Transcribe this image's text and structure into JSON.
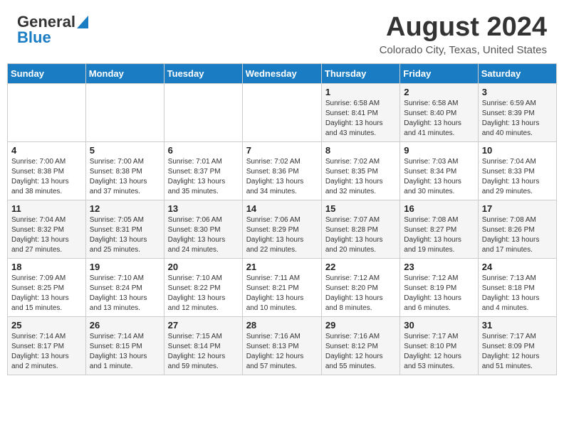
{
  "header": {
    "logo_line1": "General",
    "logo_line2": "Blue",
    "month_year": "August 2024",
    "location": "Colorado City, Texas, United States"
  },
  "weekdays": [
    "Sunday",
    "Monday",
    "Tuesday",
    "Wednesday",
    "Thursday",
    "Friday",
    "Saturday"
  ],
  "weeks": [
    [
      {
        "day": "",
        "info": ""
      },
      {
        "day": "",
        "info": ""
      },
      {
        "day": "",
        "info": ""
      },
      {
        "day": "",
        "info": ""
      },
      {
        "day": "1",
        "info": "Sunrise: 6:58 AM\nSunset: 8:41 PM\nDaylight: 13 hours\nand 43 minutes."
      },
      {
        "day": "2",
        "info": "Sunrise: 6:58 AM\nSunset: 8:40 PM\nDaylight: 13 hours\nand 41 minutes."
      },
      {
        "day": "3",
        "info": "Sunrise: 6:59 AM\nSunset: 8:39 PM\nDaylight: 13 hours\nand 40 minutes."
      }
    ],
    [
      {
        "day": "4",
        "info": "Sunrise: 7:00 AM\nSunset: 8:38 PM\nDaylight: 13 hours\nand 38 minutes."
      },
      {
        "day": "5",
        "info": "Sunrise: 7:00 AM\nSunset: 8:38 PM\nDaylight: 13 hours\nand 37 minutes."
      },
      {
        "day": "6",
        "info": "Sunrise: 7:01 AM\nSunset: 8:37 PM\nDaylight: 13 hours\nand 35 minutes."
      },
      {
        "day": "7",
        "info": "Sunrise: 7:02 AM\nSunset: 8:36 PM\nDaylight: 13 hours\nand 34 minutes."
      },
      {
        "day": "8",
        "info": "Sunrise: 7:02 AM\nSunset: 8:35 PM\nDaylight: 13 hours\nand 32 minutes."
      },
      {
        "day": "9",
        "info": "Sunrise: 7:03 AM\nSunset: 8:34 PM\nDaylight: 13 hours\nand 30 minutes."
      },
      {
        "day": "10",
        "info": "Sunrise: 7:04 AM\nSunset: 8:33 PM\nDaylight: 13 hours\nand 29 minutes."
      }
    ],
    [
      {
        "day": "11",
        "info": "Sunrise: 7:04 AM\nSunset: 8:32 PM\nDaylight: 13 hours\nand 27 minutes."
      },
      {
        "day": "12",
        "info": "Sunrise: 7:05 AM\nSunset: 8:31 PM\nDaylight: 13 hours\nand 25 minutes."
      },
      {
        "day": "13",
        "info": "Sunrise: 7:06 AM\nSunset: 8:30 PM\nDaylight: 13 hours\nand 24 minutes."
      },
      {
        "day": "14",
        "info": "Sunrise: 7:06 AM\nSunset: 8:29 PM\nDaylight: 13 hours\nand 22 minutes."
      },
      {
        "day": "15",
        "info": "Sunrise: 7:07 AM\nSunset: 8:28 PM\nDaylight: 13 hours\nand 20 minutes."
      },
      {
        "day": "16",
        "info": "Sunrise: 7:08 AM\nSunset: 8:27 PM\nDaylight: 13 hours\nand 19 minutes."
      },
      {
        "day": "17",
        "info": "Sunrise: 7:08 AM\nSunset: 8:26 PM\nDaylight: 13 hours\nand 17 minutes."
      }
    ],
    [
      {
        "day": "18",
        "info": "Sunrise: 7:09 AM\nSunset: 8:25 PM\nDaylight: 13 hours\nand 15 minutes."
      },
      {
        "day": "19",
        "info": "Sunrise: 7:10 AM\nSunset: 8:24 PM\nDaylight: 13 hours\nand 13 minutes."
      },
      {
        "day": "20",
        "info": "Sunrise: 7:10 AM\nSunset: 8:22 PM\nDaylight: 13 hours\nand 12 minutes."
      },
      {
        "day": "21",
        "info": "Sunrise: 7:11 AM\nSunset: 8:21 PM\nDaylight: 13 hours\nand 10 minutes."
      },
      {
        "day": "22",
        "info": "Sunrise: 7:12 AM\nSunset: 8:20 PM\nDaylight: 13 hours\nand 8 minutes."
      },
      {
        "day": "23",
        "info": "Sunrise: 7:12 AM\nSunset: 8:19 PM\nDaylight: 13 hours\nand 6 minutes."
      },
      {
        "day": "24",
        "info": "Sunrise: 7:13 AM\nSunset: 8:18 PM\nDaylight: 13 hours\nand 4 minutes."
      }
    ],
    [
      {
        "day": "25",
        "info": "Sunrise: 7:14 AM\nSunset: 8:17 PM\nDaylight: 13 hours\nand 2 minutes."
      },
      {
        "day": "26",
        "info": "Sunrise: 7:14 AM\nSunset: 8:15 PM\nDaylight: 13 hours\nand 1 minute."
      },
      {
        "day": "27",
        "info": "Sunrise: 7:15 AM\nSunset: 8:14 PM\nDaylight: 12 hours\nand 59 minutes."
      },
      {
        "day": "28",
        "info": "Sunrise: 7:16 AM\nSunset: 8:13 PM\nDaylight: 12 hours\nand 57 minutes."
      },
      {
        "day": "29",
        "info": "Sunrise: 7:16 AM\nSunset: 8:12 PM\nDaylight: 12 hours\nand 55 minutes."
      },
      {
        "day": "30",
        "info": "Sunrise: 7:17 AM\nSunset: 8:10 PM\nDaylight: 12 hours\nand 53 minutes."
      },
      {
        "day": "31",
        "info": "Sunrise: 7:17 AM\nSunset: 8:09 PM\nDaylight: 12 hours\nand 51 minutes."
      }
    ]
  ]
}
